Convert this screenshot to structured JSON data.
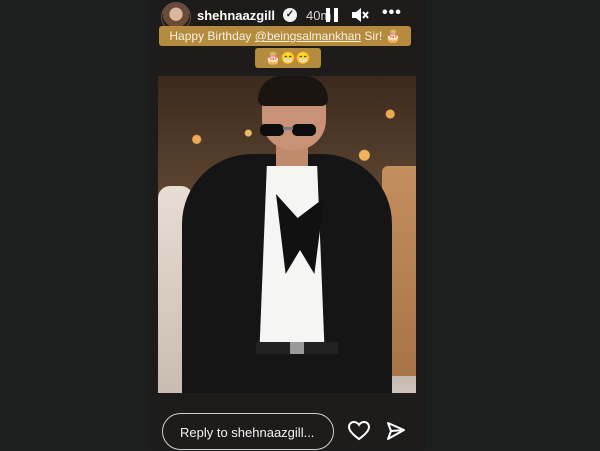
{
  "header": {
    "username": "shehnaazgill",
    "time": "40m",
    "verified_icon": "verified-badge-icon",
    "pause_icon": "pause-icon",
    "mute_icon": "muted-speaker-icon",
    "more_icon": "more-options-icon",
    "more_glyph": "•••"
  },
  "caption": {
    "line1_prefix": "Happy Birthday ",
    "mention": "@beingsalmankhan",
    "line1_suffix": " Sir! 🎂",
    "line2": "🎂😁😁"
  },
  "footer": {
    "reply_placeholder": "Reply to shehnaazgill...",
    "like_icon": "heart-icon",
    "share_icon": "send-icon"
  },
  "colors": {
    "caption_bg": "#b58b3d",
    "page_bg": "#1c1f1d",
    "story_bg": "#1e1c1a"
  }
}
